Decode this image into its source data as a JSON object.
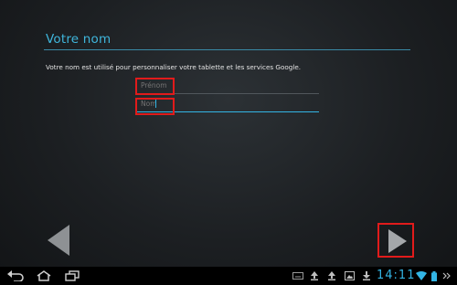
{
  "screen": {
    "title": "Votre nom",
    "description": "Votre nom est utilisé pour personnaliser votre tablette et les services Google."
  },
  "form": {
    "first_name": {
      "placeholder": "Prénom",
      "value": ""
    },
    "last_name": {
      "placeholder": "Nom",
      "value": ""
    }
  },
  "navigation": {
    "prev_icon": "left-arrow-icon",
    "next_icon": "right-arrow-icon"
  },
  "status_bar": {
    "time": "14:11",
    "icons": [
      "back-icon",
      "home-icon",
      "recent-apps-icon",
      "keyboard-icon",
      "upload-icon",
      "upload-icon",
      "image-icon",
      "download-icon",
      "wifi-icon",
      "battery-icon"
    ]
  },
  "colors": {
    "accent": "#33b5e5",
    "highlight": "#e11b1b",
    "text": "#e4e4e4"
  }
}
